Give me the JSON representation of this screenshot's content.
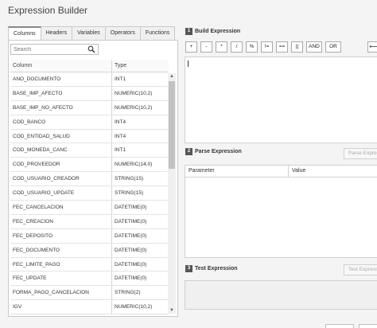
{
  "window": {
    "title": "Expression Builder"
  },
  "tabs": [
    {
      "label": "Columns",
      "active": true
    },
    {
      "label": "Headers",
      "active": false
    },
    {
      "label": "Variables",
      "active": false
    },
    {
      "label": "Operators",
      "active": false
    },
    {
      "label": "Functions",
      "active": false
    }
  ],
  "search": {
    "placeholder": "Search",
    "value": ""
  },
  "columns_table": {
    "headers": [
      "Column",
      "Type"
    ],
    "rows": [
      [
        "ANO_DOCUMENTO",
        "INT1"
      ],
      [
        "BASE_IMP_AFECTO",
        "NUMERIC(10,2)"
      ],
      [
        "BASE_IMP_NO_AFECTO",
        "NUMERIC(10,2)"
      ],
      [
        "COD_BANCO",
        "INT4"
      ],
      [
        "COD_ENTIDAD_SALUD",
        "INT4"
      ],
      [
        "COD_MONEDA_CANC",
        "INT1"
      ],
      [
        "COD_PROVEEDOR",
        "NUMERIC(14,0)"
      ],
      [
        "COD_USUARIO_CREADOR",
        "STRING(15)"
      ],
      [
        "COD_USUARIO_UPDATE",
        "STRING(15)"
      ],
      [
        "FEC_CANCELACION",
        "DATETIME(0)"
      ],
      [
        "FEC_CREACION",
        "DATETIME(0)"
      ],
      [
        "FEC_DEPOSITO",
        "DATETIME(0)"
      ],
      [
        "FEC_DOCUMENTO",
        "DATETIME(0)"
      ],
      [
        "FEC_LIMITE_PAGO",
        "DATETIME(0)"
      ],
      [
        "FEC_UPDATE",
        "DATETIME(0)"
      ],
      [
        "FORMA_PAGO_CANCELACION",
        "STRING(2)"
      ],
      [
        "IGV",
        "NUMERIC(10,2)"
      ]
    ]
  },
  "build_expression": {
    "number": "1",
    "title": "Build Expression",
    "operators": [
      "+",
      "-",
      "*",
      "/",
      "%",
      "!=",
      "==",
      "||",
      "AND",
      "OR"
    ],
    "backspace": "⟵",
    "value": ""
  },
  "parse_expression": {
    "number": "2",
    "title": "Parse Expression",
    "button_label": "Parse Expression",
    "headers": [
      "Parameter",
      "Value"
    ]
  },
  "test_expression": {
    "number": "3",
    "title": "Test Expression",
    "button_label": "Test Expression"
  }
}
